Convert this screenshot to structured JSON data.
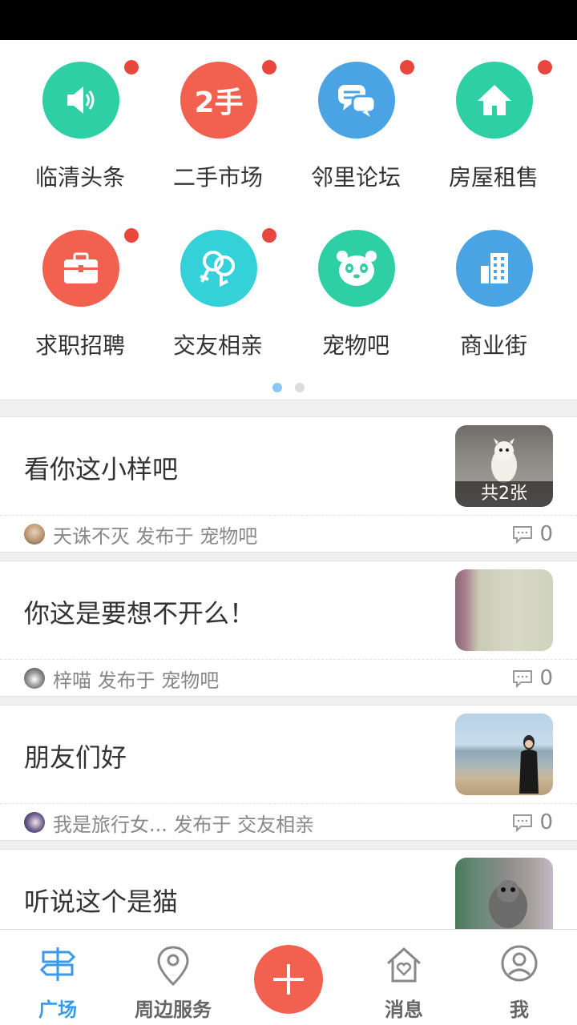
{
  "categories": [
    {
      "label": "临清头条",
      "icon": "speaker-icon",
      "color": "#2ecfa5",
      "badge": true
    },
    {
      "label": "二手市场",
      "icon": "second-hand-icon",
      "icon_text": "2手",
      "color": "#f26150",
      "badge": true
    },
    {
      "label": "邻里论坛",
      "icon": "chat-bubbles-icon",
      "color": "#4aa3e2",
      "badge": true
    },
    {
      "label": "房屋租售",
      "icon": "house-icon",
      "color": "#2ecfa5",
      "badge": true
    },
    {
      "label": "求职招聘",
      "icon": "briefcase-icon",
      "color": "#f26150",
      "badge": true
    },
    {
      "label": "交友相亲",
      "icon": "couple-icon",
      "color": "#34d1d9",
      "badge": true
    },
    {
      "label": "宠物吧",
      "icon": "panda-icon",
      "color": "#2ecfa5",
      "badge": false
    },
    {
      "label": "商业街",
      "icon": "buildings-icon",
      "color": "#4aa3e2",
      "badge": false
    }
  ],
  "pager": {
    "active_color": "#88c8f5",
    "inactive_color": "#dddddd"
  },
  "posts": [
    {
      "title": "看你这小样吧",
      "author": "天诛不灭",
      "published_in": "发布于",
      "board": "宠物吧",
      "comments": "0",
      "thumb_caption": "共2张"
    },
    {
      "title": "你这是要想不开么！",
      "author": "梓喵",
      "published_in": "发布于",
      "board": "宠物吧",
      "comments": "0"
    },
    {
      "title": "朋友们好",
      "author": "我是旅行女...",
      "published_in": "发布于",
      "board": "交友相亲",
      "comments": "0"
    },
    {
      "title": "听说这个是猫"
    }
  ],
  "tabs": [
    {
      "label": "广场",
      "icon": "signpost-icon",
      "active": true
    },
    {
      "label": "周边服务",
      "icon": "location-pin-icon"
    },
    {
      "label": "消息",
      "icon": "house-heart-icon"
    },
    {
      "label": "我",
      "icon": "person-icon"
    }
  ],
  "fab": {
    "icon": "plus-icon",
    "color": "#f26150"
  },
  "active_tab_color": "#3a9ae8"
}
